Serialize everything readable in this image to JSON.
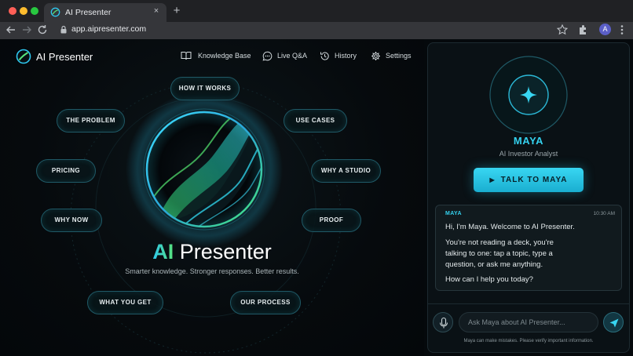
{
  "browser": {
    "tab_title": "AI Presenter",
    "tab_close": "×",
    "new_tab": "+",
    "url": "app.aipresenter.com",
    "profile_initial": "A"
  },
  "app": {
    "brand": "AI Presenter",
    "nav": [
      {
        "label": "Knowledge Base",
        "icon": "book-icon"
      },
      {
        "label": "Live Q&A",
        "icon": "chat-icon"
      },
      {
        "label": "History",
        "icon": "history-icon"
      },
      {
        "label": "Settings",
        "icon": "gear-icon"
      }
    ]
  },
  "hero": {
    "title_accent": "AI",
    "title_rest": "Presenter",
    "subtitle": "Smarter knowledge. Stronger responses. Better results."
  },
  "topics": [
    "HOW IT WORKS",
    "THE PROBLEM",
    "USE CASES",
    "PRICING",
    "WHY A STUDIO",
    "WHY NOW",
    "PROOF",
    "WHAT YOU GET",
    "OUR PROCESS"
  ],
  "agent": {
    "name": "MAYA",
    "role": "AI Investor Analyst",
    "cta": "TALK TO MAYA"
  },
  "message": {
    "sender": "MAYA",
    "time": "10:30 AM",
    "lines": [
      "Hi, I'm Maya. Welcome to AI Presenter.",
      "You're not reading a deck, you're",
      "talking to one: tap a topic, type a",
      "question, or ask me anything.",
      "How can I help you today?"
    ]
  },
  "composer": {
    "placeholder": "Ask Maya about AI Presenter...",
    "disclaimer": "Maya can make mistakes. Please verify important information."
  },
  "colors": {
    "accent": "#34d1ee",
    "accent_green": "#57e37a",
    "background": "#05090c"
  }
}
